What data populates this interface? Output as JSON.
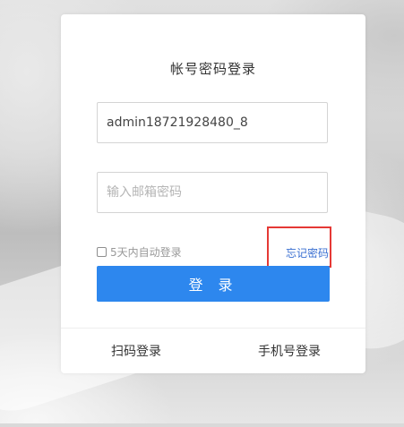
{
  "login": {
    "title": "帐号密码登录",
    "account_value": "admin18721928480_8",
    "password_placeholder": "输入邮箱密码",
    "remember_label": "5天内自动登录",
    "forgot_label": "忘记密码",
    "submit_label": "登 录",
    "qr_login_label": "扫码登录",
    "phone_login_label": "手机号登录"
  },
  "colors": {
    "primary_button": "#2d87ee",
    "link": "#3a6fd1",
    "highlight_box": "#e53935"
  }
}
